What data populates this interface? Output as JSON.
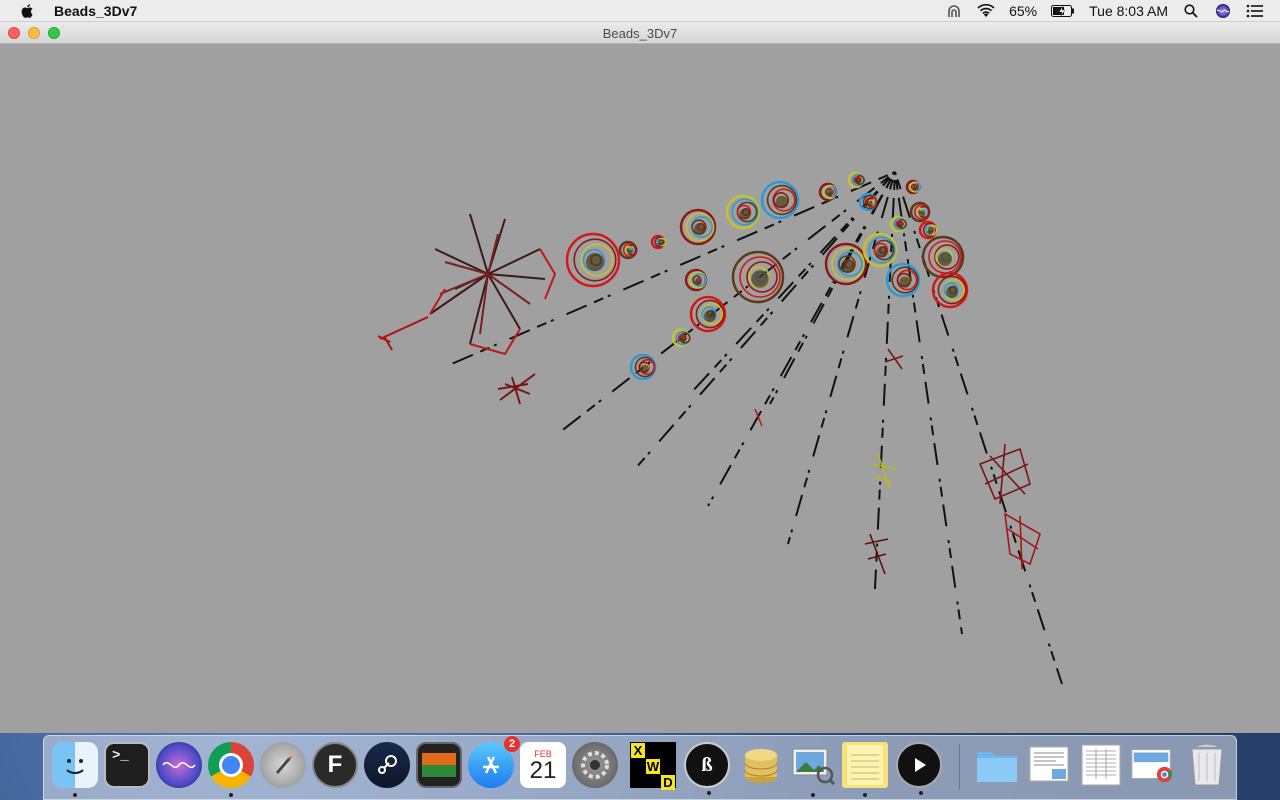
{
  "menubar": {
    "app_name": "Beads_3Dv7",
    "battery_percent": "65%",
    "clock": "Tue 8:03 AM",
    "status_icons": [
      "airdrop-icon",
      "wifi-icon",
      "battery-charging-icon",
      "search-icon",
      "siri-icon",
      "notification-center-icon"
    ]
  },
  "window": {
    "title": "Beads_3Dv7"
  },
  "dock": {
    "calendar": {
      "month": "FEB",
      "day": "21"
    },
    "app_store_badge": "2",
    "crossword_letters": [
      "X",
      "W",
      "D"
    ],
    "apps": [
      "finder-icon",
      "terminal-icon",
      "siri-icon",
      "chrome-icon",
      "launchpad-icon",
      "fontforge-icon",
      "steam-icon",
      "image-viewer-icon",
      "app-store-icon",
      "calendar-icon",
      "system-preferences-icon",
      "crossword-icon",
      "b3-icon",
      "database-icon",
      "preview-icon",
      "notes-icon",
      "player-icon"
    ],
    "right_items": [
      "downloads-folder-icon",
      "document-stack-icon",
      "spreadsheet-stack-icon",
      "chrome-document-icon",
      "trash-icon"
    ]
  }
}
